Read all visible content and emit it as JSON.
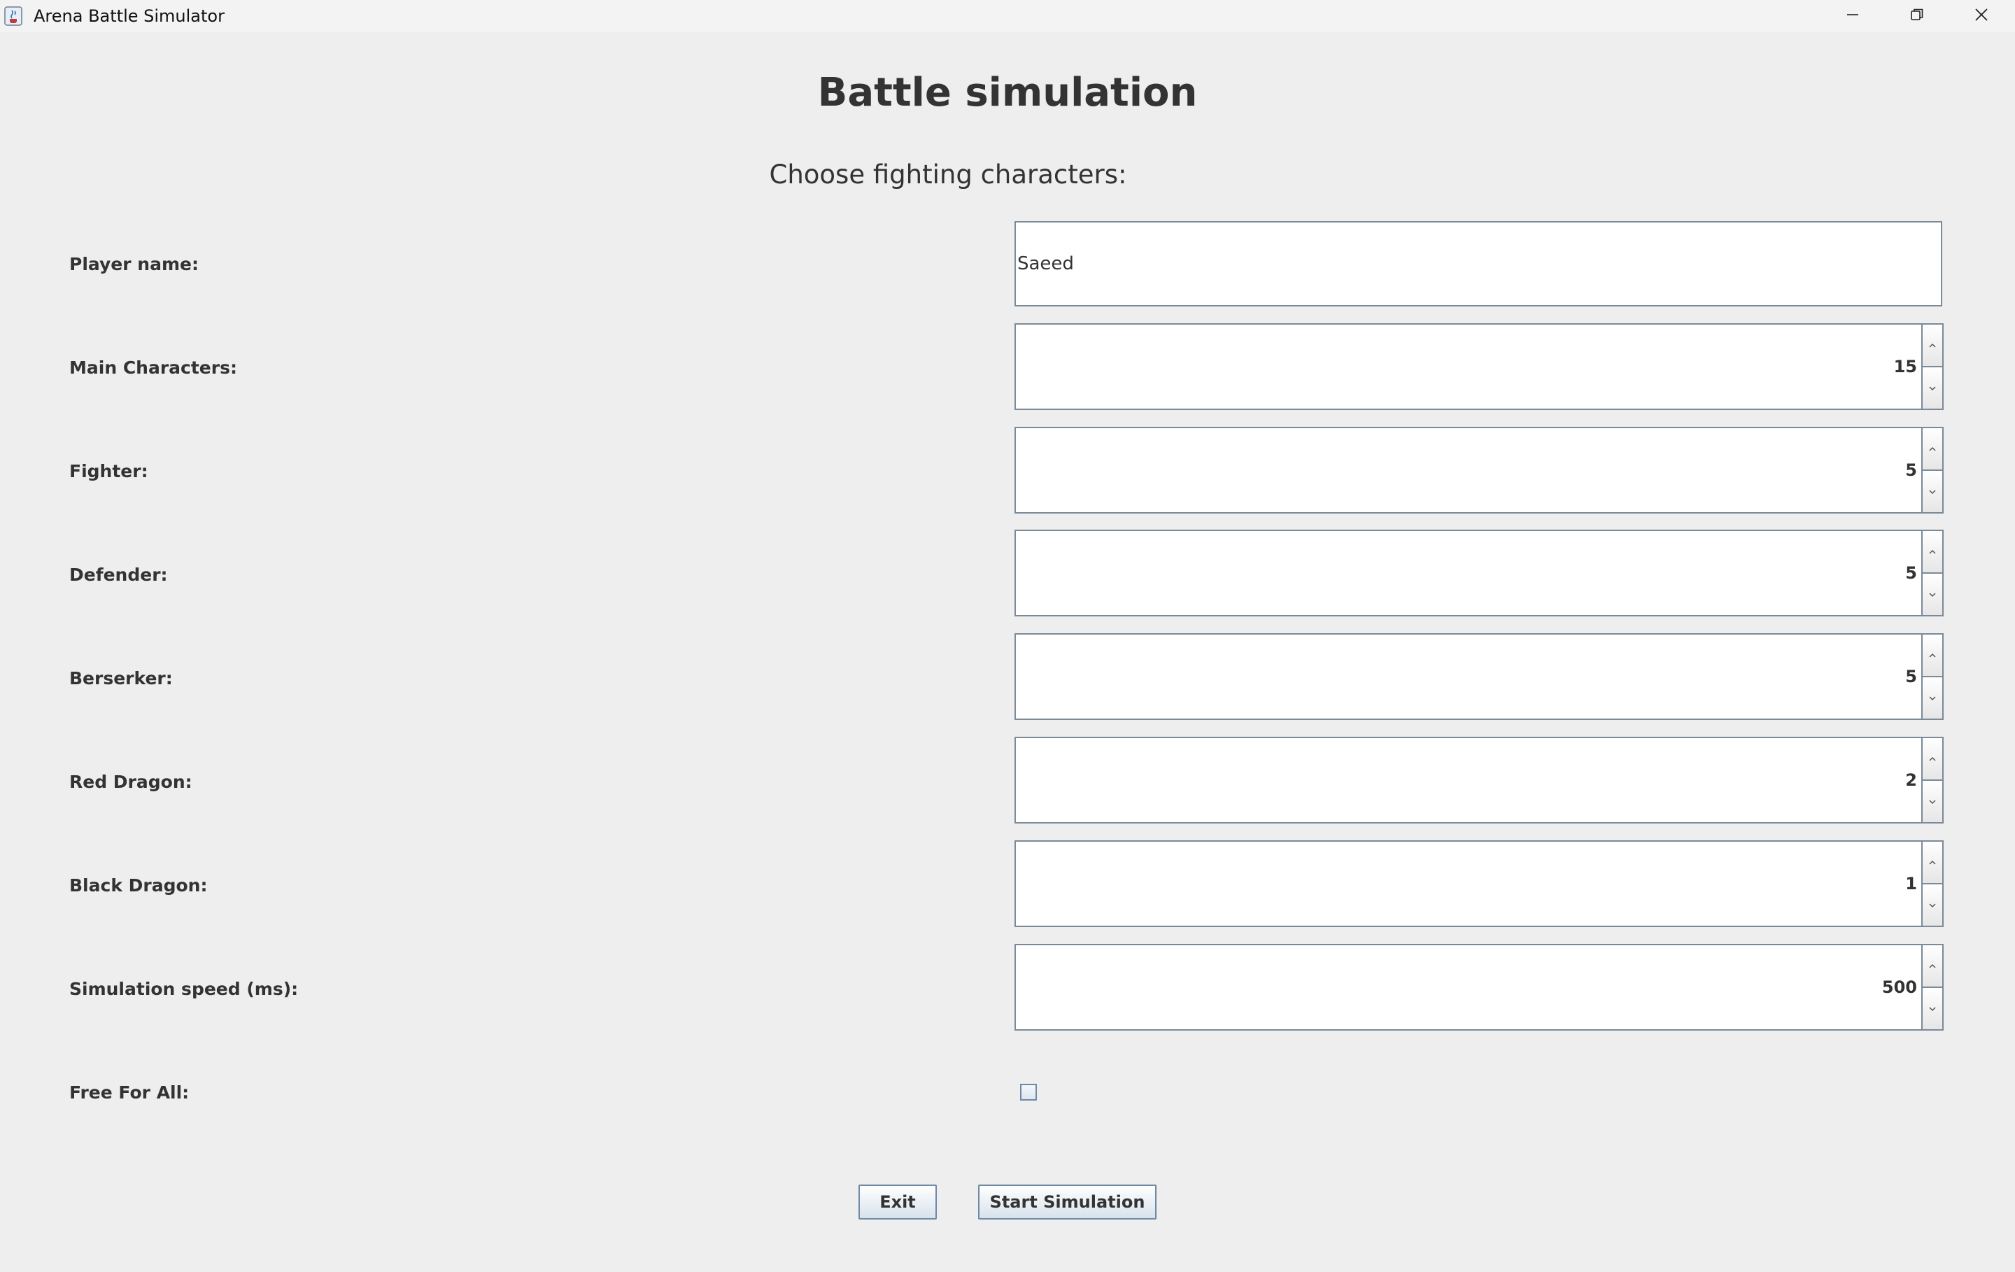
{
  "window": {
    "title": "Arena Battle Simulator",
    "icon": "java-cup-icon",
    "controls": [
      "minimize-icon",
      "restore-icon",
      "close-icon"
    ]
  },
  "header": {
    "title": "Battle simulation",
    "subtitle": "Choose fighting characters:"
  },
  "form": {
    "player_name": {
      "label": "Player name:",
      "value": "Saeed"
    },
    "spinners": [
      {
        "label": "Main Characters:",
        "value": "15"
      },
      {
        "label": "Fighter:",
        "value": "5"
      },
      {
        "label": "Defender:",
        "value": "5"
      },
      {
        "label": "Berserker:",
        "value": "5"
      },
      {
        "label": "Red Dragon:",
        "value": "2"
      },
      {
        "label": "Black Dragon:",
        "value": "1"
      },
      {
        "label": "Simulation speed (ms):",
        "value": "500"
      }
    ],
    "free_for_all": {
      "label": "Free For All:",
      "checked": false
    }
  },
  "buttons": {
    "exit": "Exit",
    "start": "Start Simulation"
  }
}
